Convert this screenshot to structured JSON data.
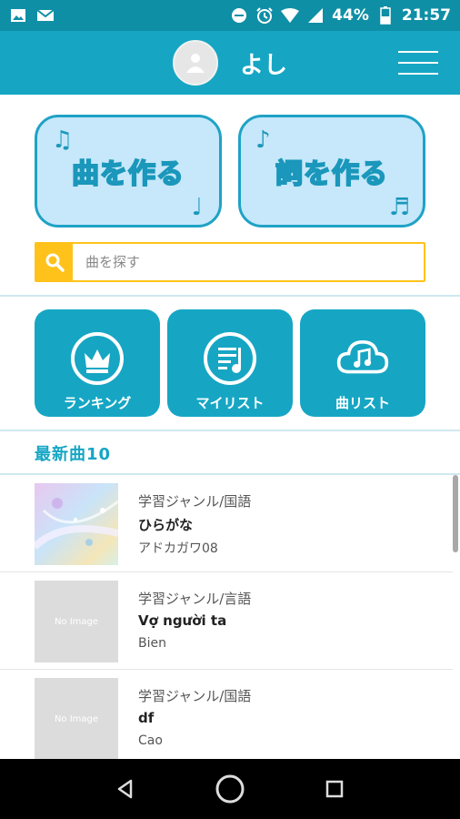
{
  "status_bar": {
    "battery": "44%",
    "time": "21:57"
  },
  "header": {
    "username": "よし"
  },
  "actions": {
    "make_song": "曲を作る",
    "make_lyrics": "詞を作る"
  },
  "search": {
    "placeholder": "曲を探す",
    "value": ""
  },
  "tiles": [
    {
      "label": "ランキング"
    },
    {
      "label": "マイリスト"
    },
    {
      "label": "曲リスト"
    }
  ],
  "section": {
    "title": "最新曲10"
  },
  "songs": [
    {
      "genre": "学習ジャンル/国語",
      "title": "ひらがな",
      "author": "アドカガワ08",
      "thumb": ""
    },
    {
      "genre": "学習ジャンル/言語",
      "title": "Vợ người ta",
      "author": "Bien",
      "thumb": "No Image"
    },
    {
      "genre": "学習ジャンル/国語",
      "title": "df",
      "author": "Cao",
      "thumb": "No Image"
    }
  ],
  "colors": {
    "header": "#16a6c4",
    "status": "#0f8fa6",
    "accent_yellow": "#ffc21a",
    "button_fill": "#c6e8fa"
  },
  "icons": {
    "status_left": [
      "image-icon",
      "mail-icon"
    ],
    "status_right": [
      "do-not-disturb-icon",
      "alarm-icon",
      "wifi-icon",
      "signal-icon",
      "battery-icon"
    ],
    "header": [
      "avatar-icon",
      "hamburger-menu-icon"
    ],
    "tiles": [
      "crown-icon",
      "playlist-icon",
      "cloud-music-icon"
    ],
    "nav": [
      "back-icon",
      "home-icon",
      "recents-icon"
    ]
  }
}
